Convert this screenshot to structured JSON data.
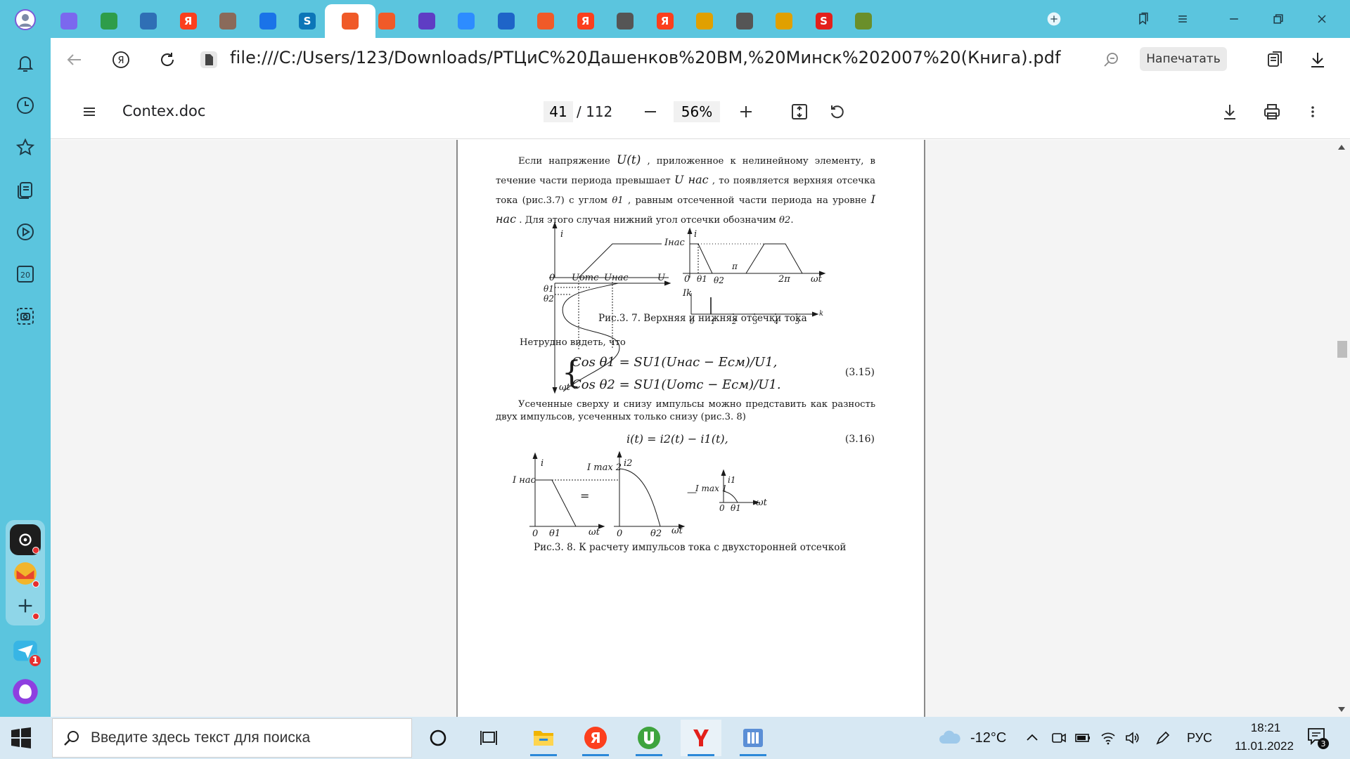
{
  "browser": {
    "tabs": [
      {
        "icon": "alice-avatar-icon",
        "color": "#7b68ee"
      },
      {
        "icon": "leaf-icon",
        "color": "#2e9d4a"
      },
      {
        "icon": "vk-groups-icon",
        "color": "#2f6fb5"
      },
      {
        "icon": "yandex-icon",
        "color": "#fc3f1d",
        "glyph": "Я"
      },
      {
        "icon": "portrait-icon",
        "color": "#8a6a5a"
      },
      {
        "icon": "chat-bubble-icon",
        "color": "#1a73e8"
      },
      {
        "icon": "skype-icon",
        "color": "#0c76b8",
        "glyph": "S"
      },
      {
        "icon": "pdf-doc-icon",
        "color": "#f05a28",
        "active": true
      },
      {
        "icon": "pdf-doc-icon",
        "color": "#f05a28"
      },
      {
        "icon": "shield-icon",
        "color": "#5f3dc4"
      },
      {
        "icon": "zoom-icon",
        "color": "#2d8cff"
      },
      {
        "icon": "swoosh-icon",
        "color": "#1e64c8"
      },
      {
        "icon": "pdf-doc-icon",
        "color": "#f05a28"
      },
      {
        "icon": "yandex-icon",
        "color": "#fc3f1d",
        "glyph": "Я"
      },
      {
        "icon": "blank-doc-icon",
        "color": "#555555"
      },
      {
        "icon": "yandex-icon",
        "color": "#fc3f1d",
        "glyph": "Я"
      },
      {
        "icon": "image-icon",
        "color": "#e0a000"
      },
      {
        "icon": "blank-doc-icon",
        "color": "#555555"
      },
      {
        "icon": "image-icon",
        "color": "#e0a000"
      },
      {
        "icon": "red-s-icon",
        "color": "#e3201b",
        "glyph": "S"
      },
      {
        "icon": "vz-icon",
        "color": "#6a8f2a"
      }
    ],
    "url": "file:///C:/Users/123/Downloads/РТЦиС%20Дашенков%20ВМ,%20Минск%202007%20(Книга).pdf",
    "print_button": "Напечатать"
  },
  "viewer": {
    "doc_title": "Contex.doc",
    "page_current": "41",
    "page_total": "/ 112",
    "zoom": "56%"
  },
  "pdf": {
    "para1_a": "Если напряжение",
    "para1_u": "U(t)",
    "para1_b": ", приложенное к нелинейному элементу, в течение части периода превышает",
    "para1_unas": "U нас",
    "para1_c": ", то появляется верхняя отсечка тока (рис.3.7) с углом",
    "para1_th1": "θ1",
    "para1_d": ",  равным отсеченной части периода на уровне",
    "para1_inas": "I нас",
    "para1_e": ". Для этого случая нижний угол отсечки обозначим",
    "para1_th2": "θ2",
    "para1_f": ".",
    "fig7": {
      "i": "i",
      "inas": "Iнас",
      "zero": "0",
      "uots": "Uотс",
      "unas": "Uнас",
      "u": "U",
      "th1": "θ1",
      "th2": "θ2",
      "wt": "ωt",
      "pi": "π",
      "twopi": "2π",
      "ik": "Ik",
      "k": "k",
      "ticks": [
        "0",
        "1",
        "2",
        "3",
        "4",
        "5"
      ]
    },
    "caption7": "Рис.3. 7.  Верхняя и нижняя отсечки тока",
    "para2": "Нетрудно видеть, что",
    "eq315_line1": "Cos θ1 = SU1(Uнас − Eсм)/U1,",
    "eq315_line2": "Cos θ2 = SU1(Uотс − Eсм)/U1.",
    "eq315_num": "(3.15)",
    "para3": "Усеченные сверху и снизу импульсы можно представить как разность двух импульсов, усеченных только снизу  (рис.3. 8)",
    "eq316": "i(t) = i2(t) − i1(t),",
    "eq316_num": "(3.16)",
    "fig8": {
      "i": "i",
      "inas": "I нас",
      "imax2": "I max 2",
      "i2": "i2",
      "imax1": "I max 1",
      "i1": "i1",
      "zero": "0",
      "th1": "θ1",
      "th2": "θ2",
      "wt": "ωt",
      "eq": "=",
      "minus": "—"
    },
    "caption8": "Рис.3. 8.  К расчету импульсов тока с двухсторонней отсечкой"
  },
  "taskbar": {
    "search_placeholder": "Введите здесь текст для поиска",
    "weather": "-12°C",
    "lang": "РУС",
    "time": "18:21",
    "date": "11.01.2022",
    "notifications": "3",
    "messenger_badge": "1"
  }
}
